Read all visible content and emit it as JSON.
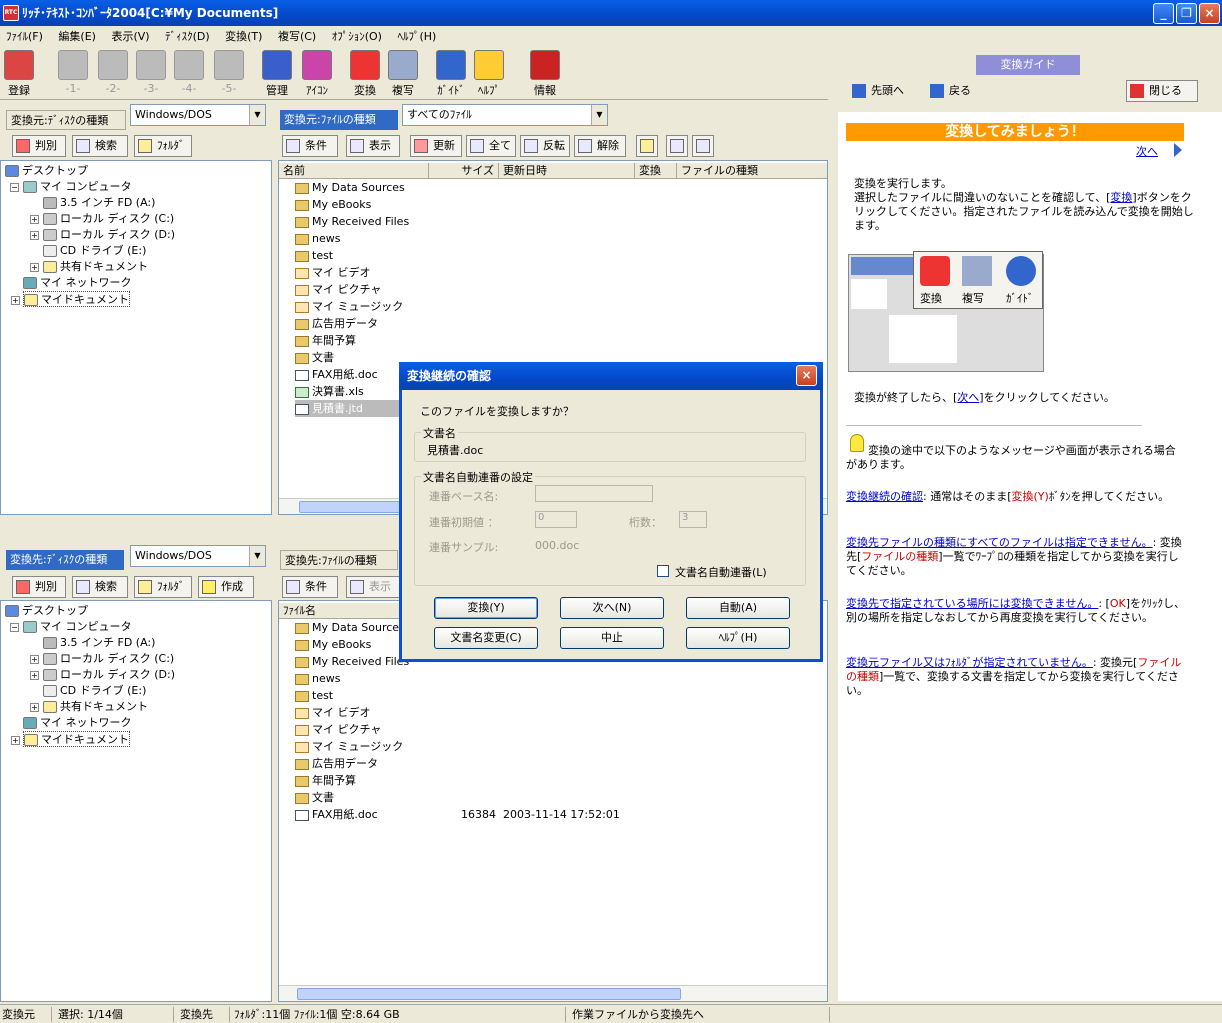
{
  "window": {
    "title": "ﾘｯﾁ･ﾃｷｽﾄ･ｺﾝﾊﾞｰﾀ2004[C:¥My Documents]",
    "app_icon_text": "RTC"
  },
  "menu": [
    "ﾌｧｲﾙ(F)",
    "編集(E)",
    "表示(V)",
    "ﾃﾞｨｽｸ(D)",
    "変換(T)",
    "複写(C)",
    "ｵﾌﾟｼｮﾝ(O)",
    "ﾍﾙﾌﾟ(H)"
  ],
  "toolbar": [
    {
      "label": "登録",
      "icon": "register-book-icon",
      "enabled": true
    },
    {
      "label": "-1-",
      "icon": "slot1-icon",
      "enabled": false
    },
    {
      "label": "-2-",
      "icon": "slot2-icon",
      "enabled": false
    },
    {
      "label": "-3-",
      "icon": "slot3-icon",
      "enabled": false
    },
    {
      "label": "-4-",
      "icon": "slot4-icon",
      "enabled": false
    },
    {
      "label": "-5-",
      "icon": "slot5-icon",
      "enabled": false
    },
    {
      "label": "管理",
      "icon": "manage-icon",
      "enabled": true
    },
    {
      "label": "ｱｲｺﾝ",
      "icon": "icon-view-icon",
      "enabled": true
    },
    {
      "label": "変換",
      "icon": "convert-icon",
      "enabled": true
    },
    {
      "label": "複写",
      "icon": "copy-icon",
      "enabled": true
    },
    {
      "label": "ｶﾞｲﾄﾞ",
      "icon": "guide-info-icon",
      "enabled": true
    },
    {
      "label": "ﾍﾙﾌﾟ",
      "icon": "help-icon",
      "enabled": true
    },
    {
      "label": "情報",
      "icon": "rtc-logo-icon",
      "enabled": true
    }
  ],
  "source": {
    "disk_label": "変換元:ﾃﾞｨｽｸの種類",
    "disk_value": "Windows/DOS",
    "buttons": [
      "判別",
      "検索",
      "ﾌｫﾙﾀﾞ"
    ],
    "tree": [
      {
        "label": "デスクトップ",
        "level": 0
      },
      {
        "label": "マイ コンピュータ",
        "level": 1
      },
      {
        "label": "3.5 インチ FD (A:)",
        "level": 2
      },
      {
        "label": "ローカル ディスク (C:)",
        "level": 2
      },
      {
        "label": "ローカル ディスク (D:)",
        "level": 2
      },
      {
        "label": "CD ドライブ (E:)",
        "level": 2
      },
      {
        "label": "共有ドキュメント",
        "level": 2
      },
      {
        "label": "マイ ネットワーク",
        "level": 1
      },
      {
        "label": "マイドキュメント",
        "level": 1
      }
    ],
    "file_type_label": "変換元:ﾌｧｲﾙの種類",
    "file_type_value": "すべてのﾌｧｲﾙ",
    "list_buttons": [
      "条件",
      "表示",
      "更新",
      "全て",
      "反転",
      "解除"
    ],
    "columns": [
      "名前",
      "サイズ",
      "更新日時",
      "変換",
      "ファイルの種類"
    ],
    "files": [
      "My Data Sources",
      "My eBooks",
      "My Received Files",
      "news",
      "test",
      "マイ ビデオ",
      "マイ ピクチャ",
      "マイ ミュージック",
      "広告用データ",
      "年間予算",
      "文書",
      "FAX用紙.doc",
      "決算書.xls",
      "見積書.jtd"
    ]
  },
  "target": {
    "disk_label": "変換先:ﾃﾞｨｽｸの種類",
    "disk_value": "Windows/DOS",
    "buttons": [
      "判別",
      "検索",
      "ﾌｫﾙﾀﾞ",
      "作成"
    ],
    "file_type_label": "変換先:ﾌｧｲﾙの種類",
    "list_buttons": [
      "条件",
      "表示"
    ],
    "columns": [
      "ﾌｧｲﾙ名"
    ],
    "files": [
      "My Data Sources",
      "My eBooks",
      "My Received Files",
      "news",
      "test",
      "マイ ビデオ",
      "マイ ピクチャ",
      "マイ ミュージック",
      "広告用データ",
      "年間予算",
      "文書",
      "FAX用紙.doc"
    ],
    "fax_size": "16384",
    "fax_date": "2003-11-14 17:52:01"
  },
  "guide": {
    "tab": "変換ガイド",
    "btn_first": "先頭へ",
    "btn_back": "戻る",
    "btn_close": "閉じる",
    "heading": "変換してみましょう！",
    "next": "次へ",
    "p1": "変換を実行します。",
    "p1b": "選択したファイルに間違いのないことを確認して、[",
    "p1link": "変換",
    "p1c": "]ボタンをクリックしてください。指定されたファイルを読み込んで変換を開始します。",
    "img_labels": [
      "変換",
      "複写",
      "ｶﾞｲﾄﾞ"
    ],
    "p2a": "変換が終了したら、[",
    "p2link": "次へ",
    "p2b": "]をクリックしてください。",
    "tip": "変換の途中で以下のようなメッセージや画面が表示される場合があります。",
    "items": [
      {
        "link": "変換継続の確認",
        "a": ": 通常はそのまま[",
        "red": "変換(Y)",
        "b": "ﾎﾞﾀﾝを押してください。"
      },
      {
        "link": "変換先ファイルの種類にすべてのファイルは指定できません。",
        "a": ": 変換先[",
        "red": "ファイルの種類",
        "b": "]一覧でﾜｰﾌﾟﾛの種類を指定してから変換を実行してください。"
      },
      {
        "link": "変換先で指定されている場所には変換できません。",
        "a": ": [",
        "red": "OK",
        "b": "]をｸﾘｯｸし、別の場所を指定しなおしてから再度変換を実行してください。"
      },
      {
        "link": "変換元ファイル又はﾌｫﾙﾀﾞが指定されていません。",
        "a": ": 変換元[",
        "red": "ファイルの種類",
        "b": "]一覧で、変換する文書を指定してから変換を実行してください。"
      }
    ]
  },
  "dialog": {
    "title": "変換継続の確認",
    "question": "このファイルを変換しますか？",
    "docname_group": "文書名",
    "docname": "見積書.doc",
    "auto_group": "文書名自動連番の設定",
    "base_label": "連番ベース名:",
    "init_label": "連番初期値 ：",
    "init_value": "0",
    "digits_label": "桁数：",
    "digits_value": "3",
    "sample_label": "連番サンプル:",
    "sample_value": "000.doc",
    "auto_check": "文書名自動連番(L)",
    "buttons": [
      "変換(Y)",
      "次へ(N)",
      "自動(A)",
      "文書名変更(C)",
      "中止",
      "ﾍﾙﾌﾟ(H)"
    ]
  },
  "status": [
    "変換元",
    "選択: 1/14個",
    "変換先",
    "ﾌｫﾙﾀﾞ:11個 ﾌｧｲﾙ:1個 空:8.64 GB",
    "作業ファイルから変換先へ"
  ]
}
